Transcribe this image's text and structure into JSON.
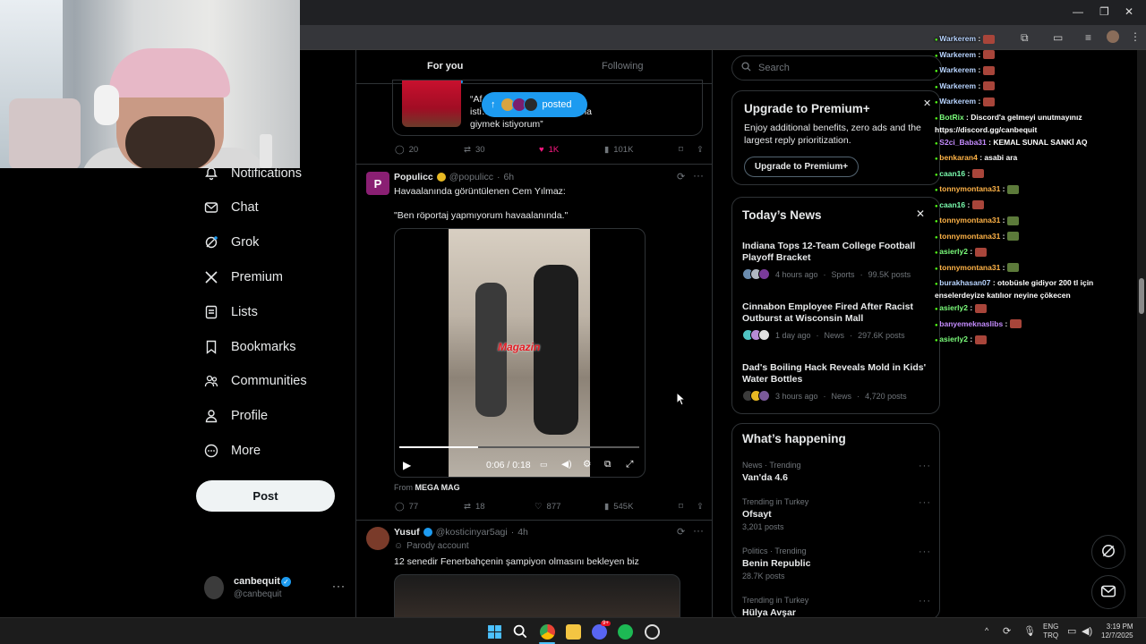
{
  "feed_tabs": [
    "For you",
    "Following"
  ],
  "nav": {
    "items": [
      {
        "label": "Notifications",
        "icon": "bell-icon"
      },
      {
        "label": "Chat",
        "icon": "mail-icon"
      },
      {
        "label": "Grok",
        "icon": "grok-icon"
      },
      {
        "label": "Premium",
        "icon": "x-logo-icon"
      },
      {
        "label": "Lists",
        "icon": "list-icon"
      },
      {
        "label": "Bookmarks",
        "icon": "bookmark-icon"
      },
      {
        "label": "Communities",
        "icon": "people-icon"
      },
      {
        "label": "Profile",
        "icon": "person-icon"
      },
      {
        "label": "More",
        "icon": "more-circle-icon"
      }
    ],
    "post_label": "Post"
  },
  "account": {
    "name": "canbequit",
    "handle": "@canbequit"
  },
  "posted_pill": {
    "label": "posted"
  },
  "tweet1": {
    "quote_text_line1": "“Af… erpool’dan ayrılmak",
    "quote_text_line2": "isti… olduğu bir ülkede forma",
    "quote_text_line3": "giymek istiyorum”",
    "replies": "20",
    "reposts": "30",
    "likes": "1K",
    "views": "101K"
  },
  "tweet2": {
    "name": "Populicc",
    "handle": "@populicc",
    "time": "6h",
    "avatar_letter": "P",
    "text1": "Havaalanında görüntülenen Cem Yılmaz:",
    "text2": "\"Ben röportaj yapmıyorum havaalanında.\"",
    "video_time": "0:06 / 0:18",
    "video_progress": 0.33,
    "video_logo": "Magazin",
    "from_label": "From",
    "from_source": "MEGA MAG",
    "replies": "77",
    "reposts": "18",
    "likes": "877",
    "views": "545K"
  },
  "tweet3": {
    "name": "Yusuf",
    "handle": "@kosticinyar5agi",
    "time": "4h",
    "badge": "Parody account",
    "text": "12 senedir Fenerbahçenin şampiyon olmasını bekleyen biz"
  },
  "search": {
    "placeholder": "Search"
  },
  "premium": {
    "title": "Upgrade to Premium+",
    "body": "Enjoy additional benefits, zero ads and the largest reply prioritization.",
    "button": "Upgrade to Premium+"
  },
  "news": {
    "title": "Today’s News",
    "items": [
      {
        "title": "Indiana Tops 12-Team College Football Playoff Bracket",
        "time": "4 hours ago",
        "category": "Sports",
        "posts": "99.5K posts"
      },
      {
        "title": "Cinnabon Employee Fired After Racist Outburst at Wisconsin Mall",
        "time": "1 day ago",
        "category": "News",
        "posts": "297.6K posts"
      },
      {
        "title": "Dad's Boiling Hack Reveals Mold in Kids' Water Bottles",
        "time": "3 hours ago",
        "category": "News",
        "posts": "4,720 posts"
      }
    ]
  },
  "happening": {
    "title": "What’s happening",
    "items": [
      {
        "meta": "News · Trending",
        "name": "Van'da 4.6",
        "posts": ""
      },
      {
        "meta": "Trending in Turkey",
        "name": "Ofsayt",
        "posts": "3,201 posts"
      },
      {
        "meta": "Politics · Trending",
        "name": "Benin Republic",
        "posts": "28.7K posts"
      },
      {
        "meta": "Trending in Turkey",
        "name": "Hülya Avşar",
        "posts": ""
      }
    ]
  },
  "chat": {
    "lines": [
      {
        "user": "Warkerem",
        "color": "#b8d4ff",
        "msg": "",
        "emote": true
      },
      {
        "user": "Warkerem",
        "color": "#b8d4ff",
        "msg": "",
        "emote": true
      },
      {
        "user": "Warkerem",
        "color": "#b8d4ff",
        "msg": "",
        "emote": true
      },
      {
        "user": "Warkerem",
        "color": "#b8d4ff",
        "msg": "",
        "emote": true
      },
      {
        "user": "Warkerem",
        "color": "#b8d4ff",
        "msg": "",
        "emote": true
      },
      {
        "user": "BotRix",
        "color": "#7cff7c",
        "msg": "Discord'a gelmeyi unutmayınız https://discord.gg/canbequit",
        "emote": false
      },
      {
        "user": "S2ci_Baba31",
        "color": "#c58cff",
        "msg": "KEMAL SUNAL SANKİ AQ",
        "emote": false
      },
      {
        "user": "benkaran4",
        "color": "#ffb347",
        "msg": "asabi ara",
        "emote": false
      },
      {
        "user": "caan16",
        "color": "#7cffb0",
        "msg": "",
        "emote": true
      },
      {
        "user": "tonnymontana31",
        "color": "#ffb347",
        "msg": "",
        "emote": true
      },
      {
        "user": "caan16",
        "color": "#7cffb0",
        "msg": "",
        "emote": true
      },
      {
        "user": "tonnymontana31",
        "color": "#ffb347",
        "msg": "",
        "emote": true
      },
      {
        "user": "tonnymontana31",
        "color": "#ffb347",
        "msg": "",
        "emote": true
      },
      {
        "user": "asierly2",
        "color": "#7cff7c",
        "msg": "",
        "emote": true
      },
      {
        "user": "tonnymontana31",
        "color": "#ffb347",
        "msg": "",
        "emote": true
      },
      {
        "user": "burakhasan07",
        "color": "#b8d4ff",
        "msg": "otobüsle gidiyor 200 tl için enselerdeyize katılıor neyine çökecen",
        "emote": false
      },
      {
        "user": "asierly2",
        "color": "#7cff7c",
        "msg": "",
        "emote": true
      },
      {
        "user": "banyemeknaslibs",
        "color": "#c58cff",
        "msg": "",
        "emote": true
      },
      {
        "user": "asierly2",
        "color": "#7cff7c",
        "msg": "",
        "emote": true
      }
    ]
  },
  "taskbar": {
    "lang": "ENG",
    "layout": "TRQ",
    "time": "3:19 PM",
    "date": "12/7/2025",
    "discord_badge": "9+"
  },
  "colors": {
    "accent": "#1d9bf0",
    "like": "#f91880",
    "bg": "#000000"
  }
}
